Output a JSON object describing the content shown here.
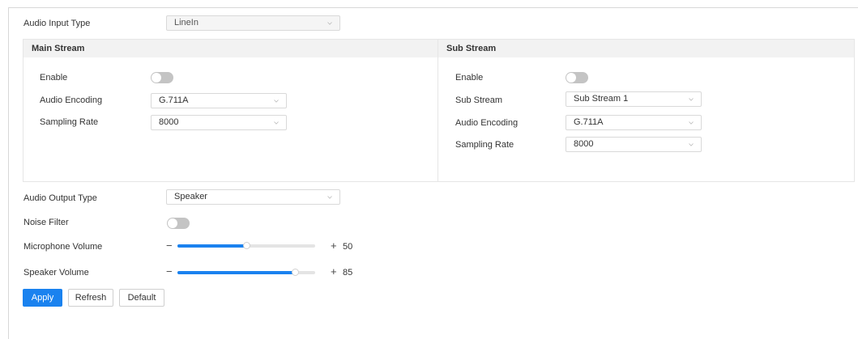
{
  "audio_input": {
    "label": "Audio Input Type",
    "value": "LineIn"
  },
  "main_stream": {
    "title": "Main Stream",
    "enable_label": "Enable",
    "enabled": false,
    "encoding_label": "Audio Encoding",
    "encoding_value": "G.711A",
    "sampling_label": "Sampling Rate",
    "sampling_value": "8000"
  },
  "sub_stream": {
    "title": "Sub Stream",
    "enable_label": "Enable",
    "enabled": false,
    "stream_label": "Sub Stream",
    "stream_value": "Sub Stream 1",
    "encoding_label": "Audio Encoding",
    "encoding_value": "G.711A",
    "sampling_label": "Sampling Rate",
    "sampling_value": "8000"
  },
  "audio_output": {
    "label": "Audio Output Type",
    "value": "Speaker"
  },
  "noise_filter": {
    "label": "Noise Filter",
    "enabled": false
  },
  "microphone_volume": {
    "label": "Microphone Volume",
    "value": 50,
    "minus": "−",
    "plus": "+"
  },
  "speaker_volume": {
    "label": "Speaker Volume",
    "value": 85,
    "minus": "−",
    "plus": "+"
  },
  "buttons": {
    "apply": "Apply",
    "refresh": "Refresh",
    "default": "Default"
  },
  "colors": {
    "accent": "#1a82ef",
    "toggle_off": "#c4c4c4",
    "panel_header": "#f2f2f2"
  },
  "icons": {
    "dropdown": "chevron-down-icon"
  }
}
